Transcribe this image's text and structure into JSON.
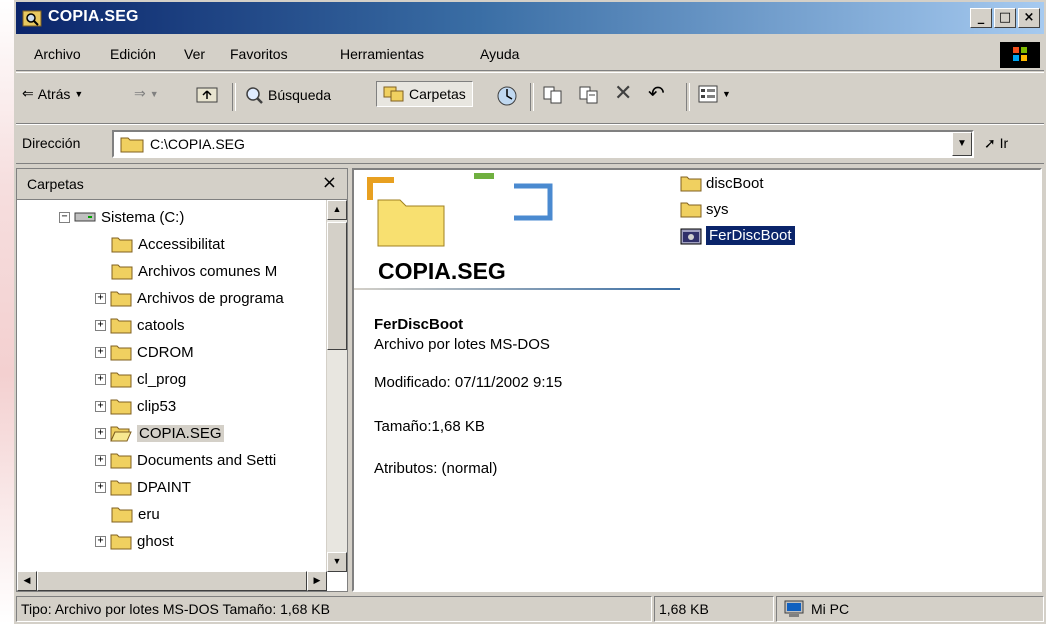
{
  "window": {
    "title": "COPIA.SEG"
  },
  "menu": {
    "items": [
      "Archivo",
      "Edición",
      "Ver",
      "Favoritos",
      "Herramientas",
      "Ayuda"
    ]
  },
  "toolbar": {
    "back": "Atrás",
    "search": "Búsqueda",
    "folders": "Carpetas"
  },
  "address": {
    "label": "Dirección",
    "value": "C:\\COPIA.SEG",
    "go": "Ir"
  },
  "folders_pane": {
    "title": "Carpetas",
    "tree": [
      {
        "label": "Sistema (C:)",
        "expanded": true,
        "type": "drive"
      },
      {
        "label": "Accessibilitat",
        "expandable": false
      },
      {
        "label": "Archivos comunes M",
        "expandable": false
      },
      {
        "label": "Archivos de programa",
        "expandable": true
      },
      {
        "label": "catools",
        "expandable": true
      },
      {
        "label": "CDROM",
        "expandable": true
      },
      {
        "label": "cl_prog",
        "expandable": true
      },
      {
        "label": "clip53",
        "expandable": true
      },
      {
        "label": "COPIA.SEG",
        "expandable": true,
        "selected": true,
        "open": true
      },
      {
        "label": "Documents and Setti",
        "expandable": true
      },
      {
        "label": "DPAINT",
        "expandable": true
      },
      {
        "label": "eru",
        "expandable": false
      },
      {
        "label": "ghost",
        "expandable": true
      }
    ]
  },
  "content": {
    "folder_name": "COPIA.SEG",
    "selected_name": "FerDiscBoot",
    "selected_type": "Archivo por lotes MS-DOS",
    "modified": "Modificado: 07/11/2002 9:15",
    "size": "Tamaño:1,68 KB",
    "attributes": "Atributos: (normal)",
    "files": [
      {
        "name": "discBoot",
        "kind": "folder"
      },
      {
        "name": "sys",
        "kind": "folder"
      },
      {
        "name": "FerDiscBoot",
        "kind": "batch",
        "selected": true
      }
    ]
  },
  "status": {
    "info": "Tipo: Archivo por lotes MS-DOS Tamaño: 1,68 KB",
    "size": "1,68 KB",
    "zone": "Mi PC"
  }
}
